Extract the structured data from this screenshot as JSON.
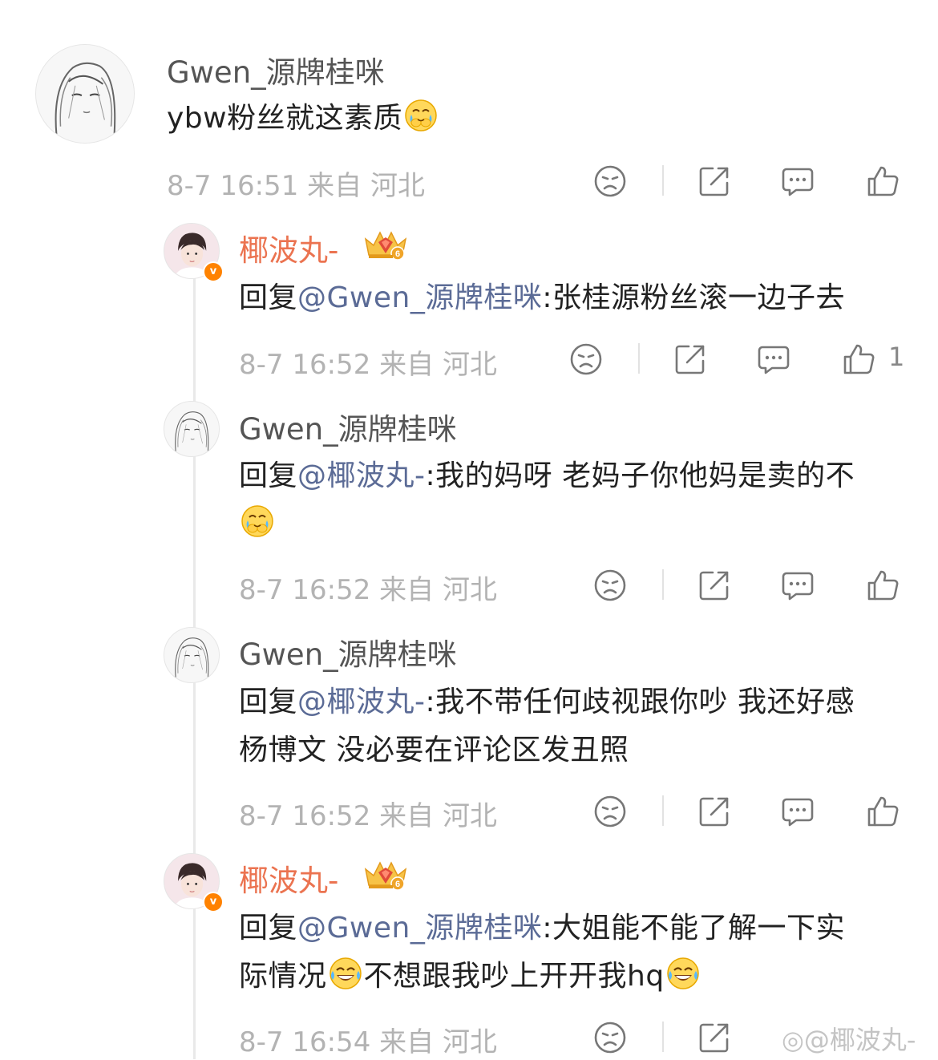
{
  "main_comment": {
    "username": "Gwen_源牌桂咪",
    "text": "ybw粉丝就这素质",
    "emoji": "cry-laugh-face",
    "time": "8-7 16:51",
    "location": "来自 河北"
  },
  "replies": [
    {
      "username": "椰波丸-",
      "verified_badge": "v",
      "vip_level": "6",
      "reply_prefix": "回复",
      "mention": "@Gwen_源牌桂咪",
      "text": ":张桂源粉丝滚一边子去",
      "time": "8-7 16:52",
      "location": "来自 河北",
      "like_count": "1"
    },
    {
      "username": "Gwen_源牌桂咪",
      "reply_prefix": "回复",
      "mention": "@椰波丸-",
      "text": ":我的妈呀 老妈子你他妈是卖的不",
      "emoji": "cry-laugh-face",
      "time": "8-7 16:52",
      "location": "来自 河北"
    },
    {
      "username": "Gwen_源牌桂咪",
      "reply_prefix": "回复",
      "mention": "@椰波丸-",
      "text_line1": ":我不带任何歧视跟你吵 我还好感",
      "text_line2": "杨博文 没必要在评论区发丑照",
      "time": "8-7 16:52",
      "location": "来自 河北"
    },
    {
      "username": "椰波丸-",
      "verified_badge": "v",
      "vip_level": "6",
      "reply_prefix": "回复",
      "mention": "@Gwen_源牌桂咪",
      "text_line1": ":大姐能不能了解一下实",
      "text_line2a": "际情况",
      "text_line2b": "不想跟我吵上开开我hq",
      "emoji": "tears-of-joy-face",
      "time": "8-7 16:54",
      "location": "来自 河北"
    }
  ],
  "watermark": "@椰波丸-",
  "colors": {
    "username_default": "#555555",
    "username_vip": "#eb7350",
    "mention": "#5b6b96",
    "meta": "#b3b3b3",
    "icon": "#777777"
  },
  "icons": [
    "dislike-face-icon",
    "share-icon",
    "comment-icon",
    "like-icon"
  ]
}
